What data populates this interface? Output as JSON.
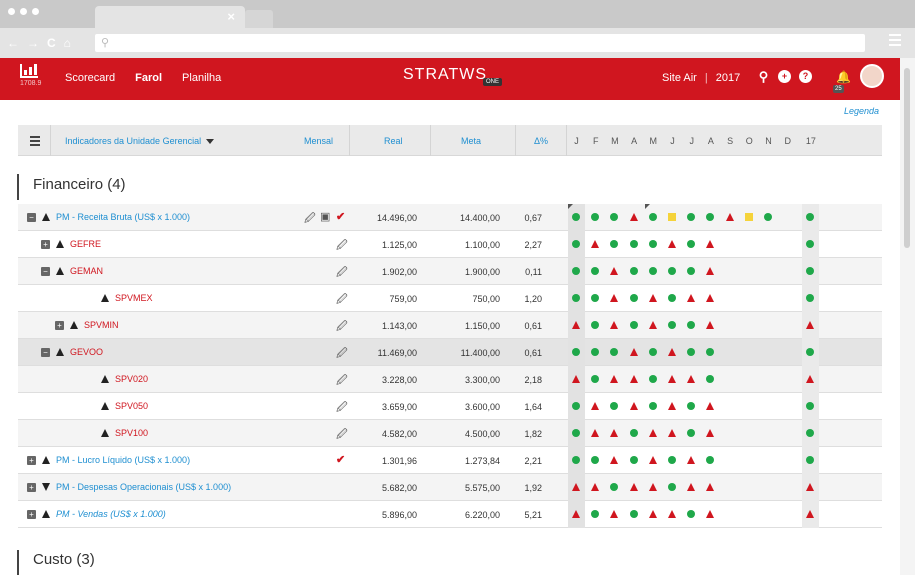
{
  "browser": {
    "url": ""
  },
  "app": {
    "logo_number": "1708.9",
    "nav": [
      "Scorecard",
      "Farol",
      "Planilha"
    ],
    "active_nav": "Farol",
    "brand": "STRATWS",
    "brand_badge": "ONE",
    "site": "Site Air",
    "year": "2017",
    "notification_count": "25"
  },
  "legend_link": "Legenda",
  "table": {
    "header": {
      "indicator_label": "Indicadores da Unidade Gerencial",
      "period": "Mensal",
      "real": "Real",
      "meta": "Meta",
      "delta": "Δ%",
      "months": [
        "J",
        "F",
        "M",
        "A",
        "M",
        "J",
        "J",
        "A",
        "S",
        "O",
        "N",
        "D",
        "17"
      ]
    },
    "sections": [
      {
        "title": "Financeiro (4)"
      },
      {
        "title": "Custo (3)"
      }
    ],
    "rows": [
      {
        "name": "PM - Receita Bruta (US$ x 1.000)",
        "real": "14.496,00",
        "meta": "14.400,00",
        "delta": "0,67",
        "status": [
          "g",
          "g",
          "g",
          "r",
          "g",
          "y",
          "g",
          "g",
          "r",
          "y",
          "g",
          "",
          ""
        ],
        "final": "g"
      },
      {
        "name": "GEFRE",
        "real": "1.125,00",
        "meta": "1.100,00",
        "delta": "2,27",
        "status": [
          "g",
          "r",
          "g",
          "g",
          "g",
          "r",
          "g",
          "r",
          "",
          "",
          "",
          "",
          ""
        ],
        "final": "g"
      },
      {
        "name": "GEMAN",
        "real": "1.902,00",
        "meta": "1.900,00",
        "delta": "0,11",
        "status": [
          "g",
          "g",
          "r",
          "g",
          "g",
          "g",
          "g",
          "r",
          "",
          "",
          "",
          "",
          ""
        ],
        "final": "g"
      },
      {
        "name": "SPVMEX",
        "real": "759,00",
        "meta": "750,00",
        "delta": "1,20",
        "status": [
          "g",
          "g",
          "r",
          "g",
          "r",
          "g",
          "r",
          "r",
          "",
          "",
          "",
          "",
          ""
        ],
        "final": "g"
      },
      {
        "name": "SPVMIN",
        "real": "1.143,00",
        "meta": "1.150,00",
        "delta": "0,61",
        "status": [
          "r",
          "g",
          "r",
          "g",
          "r",
          "g",
          "g",
          "r",
          "",
          "",
          "",
          "",
          ""
        ],
        "final": "r"
      },
      {
        "name": "GEVOO",
        "real": "11.469,00",
        "meta": "11.400,00",
        "delta": "0,61",
        "status": [
          "g",
          "g",
          "g",
          "r",
          "g",
          "r",
          "g",
          "g",
          "",
          "",
          "",
          "",
          ""
        ],
        "final": "g"
      },
      {
        "name": "SPV020",
        "real": "3.228,00",
        "meta": "3.300,00",
        "delta": "2,18",
        "status": [
          "r",
          "g",
          "r",
          "r",
          "g",
          "r",
          "r",
          "g",
          "",
          "",
          "",
          "",
          ""
        ],
        "final": "r"
      },
      {
        "name": "SPV050",
        "real": "3.659,00",
        "meta": "3.600,00",
        "delta": "1,64",
        "status": [
          "g",
          "r",
          "g",
          "r",
          "g",
          "r",
          "g",
          "r",
          "",
          "",
          "",
          "",
          ""
        ],
        "final": "g"
      },
      {
        "name": "SPV100",
        "real": "4.582,00",
        "meta": "4.500,00",
        "delta": "1,82",
        "status": [
          "g",
          "r",
          "r",
          "g",
          "r",
          "r",
          "g",
          "r",
          "",
          "",
          "",
          "",
          ""
        ],
        "final": "g"
      },
      {
        "name": "PM - Lucro Líquido (US$ x 1.000)",
        "real": "1.301,96",
        "meta": "1.273,84",
        "delta": "2,21",
        "status": [
          "g",
          "g",
          "r",
          "g",
          "r",
          "g",
          "r",
          "g",
          "",
          "",
          "",
          "",
          ""
        ],
        "final": "g"
      },
      {
        "name": "PM - Despesas Operacionais (US$ x 1.000)",
        "real": "5.682,00",
        "meta": "5.575,00",
        "delta": "1,92",
        "status": [
          "r",
          "r",
          "g",
          "r",
          "r",
          "g",
          "r",
          "r",
          "",
          "",
          "",
          "",
          ""
        ],
        "final": "r"
      },
      {
        "name": "PM - Vendas (US$ x 1.000)",
        "real": "5.896,00",
        "meta": "6.220,00",
        "delta": "5,21",
        "status": [
          "r",
          "g",
          "r",
          "g",
          "r",
          "r",
          "g",
          "r",
          "",
          "",
          "",
          "",
          ""
        ],
        "final": "r"
      }
    ]
  },
  "colors": {
    "brand_red": "#d0161f",
    "link_blue": "#1f8fd1",
    "green": "#1fa84a",
    "yellow": "#f5d33a"
  },
  "icons": [
    "search-icon",
    "plus-icon",
    "help-icon",
    "bell-icon",
    "paperclip-icon",
    "checkmark-icon"
  ]
}
